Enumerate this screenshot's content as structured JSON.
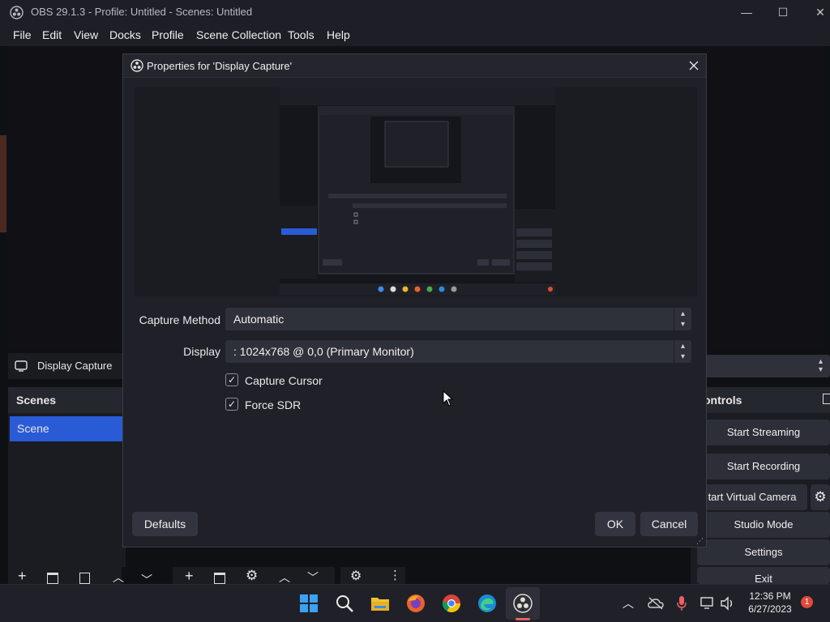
{
  "window": {
    "title": "OBS 29.1.3 - Profile: Untitled - Scenes: Untitled",
    "minimize_glyph": "—",
    "maximize_glyph": "☐",
    "close_glyph": "✕"
  },
  "menu": [
    "File",
    "Edit",
    "View",
    "Docks",
    "Profile",
    "Scene Collection",
    "Tools",
    "Help"
  ],
  "sources": {
    "selected_source": "Display Capture"
  },
  "scenes": {
    "header": "Scenes",
    "items": [
      "Scene"
    ]
  },
  "controls": {
    "header": "ontrols",
    "buttons": [
      "Start Streaming",
      "Start Recording",
      "tart Virtual Camera",
      "Studio Mode",
      "Settings",
      "Exit"
    ]
  },
  "dialog": {
    "title": "Properties for 'Display Capture'",
    "capture_method_label": "Capture Method",
    "capture_method_value": "Automatic",
    "display_label": "Display",
    "display_value": ": 1024x768 @ 0,0 (Primary Monitor)",
    "capture_cursor_label": "Capture Cursor",
    "capture_cursor_checked": true,
    "force_sdr_label": "Force SDR",
    "force_sdr_checked": true,
    "defaults_button": "Defaults",
    "ok_button": "OK",
    "cancel_button": "Cancel"
  },
  "taskbar": {
    "icons": [
      "windows-start-icon",
      "search-icon",
      "file-explorer-icon",
      "firefox-icon",
      "chrome-icon",
      "edge-icon",
      "obs-icon"
    ],
    "time": "12:36 PM",
    "date": "6/27/2023",
    "notification_count": "1"
  },
  "colors": {
    "accent": "#2a5bd7",
    "dialog_bg": "#1f2028",
    "notification": "#e04a3a"
  }
}
